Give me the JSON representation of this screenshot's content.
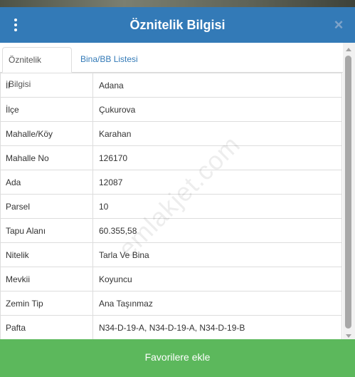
{
  "header": {
    "title": "Öznitelik Bilgisi",
    "close_symbol": "×",
    "menu_icon": "vertical-dots-icon"
  },
  "tabs": [
    {
      "label": "Öznitelik Bilgisi",
      "active": true
    },
    {
      "label": "Bina/BB Listesi",
      "active": false
    }
  ],
  "attributes": [
    {
      "key": "İl",
      "value": "Adana"
    },
    {
      "key": "İlçe",
      "value": "Çukurova"
    },
    {
      "key": "Mahalle/Köy",
      "value": "Karahan"
    },
    {
      "key": "Mahalle No",
      "value": "126170"
    },
    {
      "key": "Ada",
      "value": "12087"
    },
    {
      "key": "Parsel",
      "value": "10"
    },
    {
      "key": "Tapu Alanı",
      "value": "60.355,58"
    },
    {
      "key": "Nitelik",
      "value": "Tarla Ve Bina"
    },
    {
      "key": "Mevkii",
      "value": "Koyuncu"
    },
    {
      "key": "Zemin Tip",
      "value": "Ana Taşınmaz"
    },
    {
      "key": "Pafta",
      "value": "N34-D-19-A, N34-D-19-A, N34-D-19-B"
    }
  ],
  "footer": {
    "button_label": "Favorilere ekle"
  },
  "watermark": "emlakjet.com",
  "colors": {
    "header": "#337ab7",
    "footer_button": "#5cb85c",
    "tab_link": "#337ab7"
  }
}
